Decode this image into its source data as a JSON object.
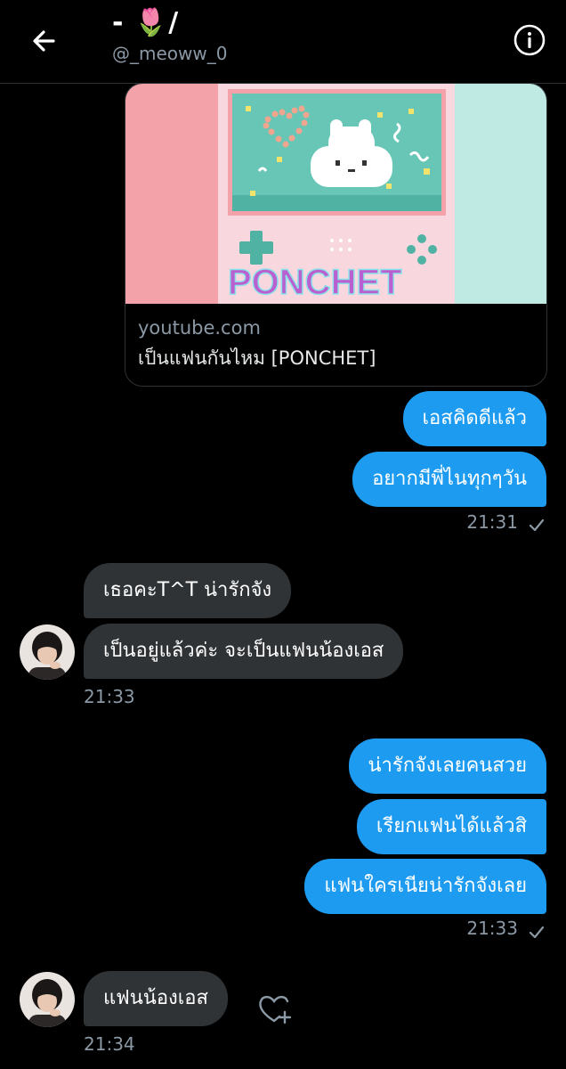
{
  "header": {
    "title": "- 🌷/",
    "handle": "@_meoww_0"
  },
  "link_card": {
    "thumbnail_text": "PONCHET",
    "domain": "youtube.com",
    "title": "เป็นแฟนกันไหม [PONCHET]"
  },
  "messages": [
    {
      "side": "sent",
      "text": "เอสคิดดีแล้ว"
    },
    {
      "side": "sent",
      "text": "อยากมีพี่ไนทุกๆวัน"
    },
    {
      "side": "sent_time",
      "text": "21:31"
    },
    {
      "side": "recv",
      "text": "เธอคะT^T น่ารักจัง"
    },
    {
      "side": "recv",
      "text": "เป็นอยู่แล้วค่ะ จะเป็นแฟนน้องเอส"
    },
    {
      "side": "recv_time",
      "text": "21:33"
    },
    {
      "side": "sent",
      "text": "น่ารักจังเลยคนสวย"
    },
    {
      "side": "sent",
      "text": "เรียกแฟนได้แล้วสิ"
    },
    {
      "side": "sent",
      "text": "แฟนใครเนียน่ารักจังเลย"
    },
    {
      "side": "sent_time",
      "text": "21:33"
    },
    {
      "side": "recv",
      "text": "แฟนน้องเอส"
    },
    {
      "side": "recv_time",
      "text": "21:34"
    }
  ],
  "colors": {
    "sent_bubble": "#1d9bf0",
    "recv_bubble": "#2f3336",
    "background": "#000000",
    "muted_text": "#8b98a5"
  },
  "icons": [
    "back-arrow-icon",
    "info-icon",
    "read-check-icon",
    "add-reaction-icon"
  ]
}
